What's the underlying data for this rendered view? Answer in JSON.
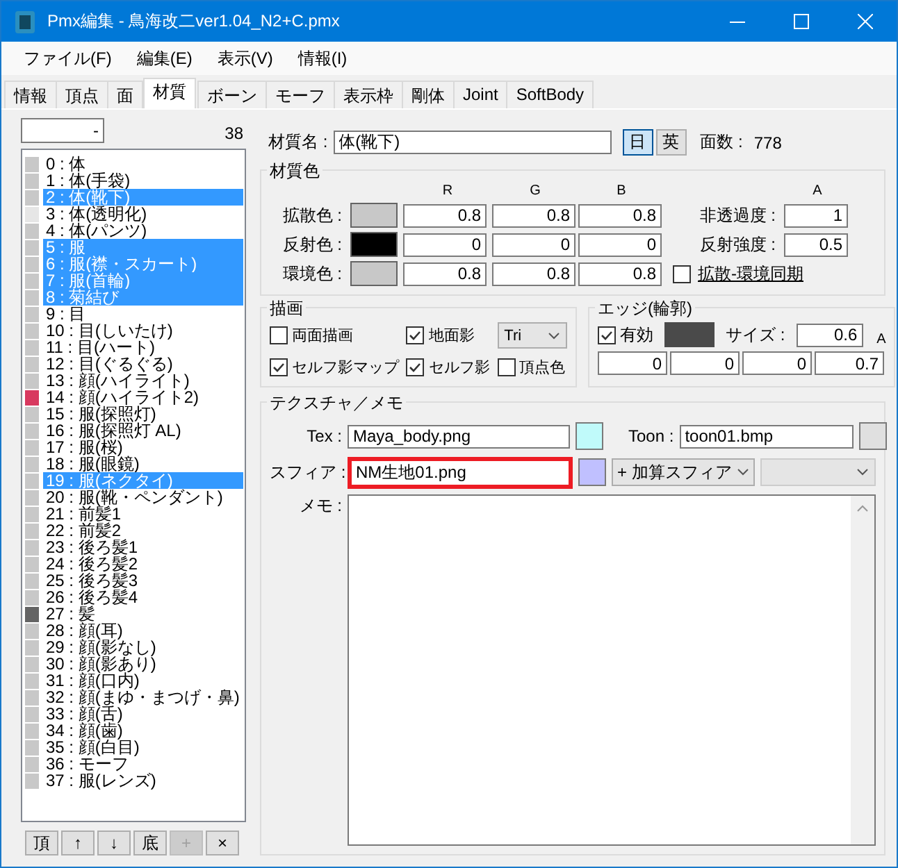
{
  "window": {
    "title": "Pmx編集 - 鳥海改二ver1.04_N2+C.pmx"
  },
  "menu": [
    "ファイル(F)",
    "編集(E)",
    "表示(V)",
    "情報(I)"
  ],
  "tabs": [
    {
      "label": "情報",
      "selected": false
    },
    {
      "label": "頂点",
      "selected": false
    },
    {
      "label": "面",
      "selected": false
    },
    {
      "label": "材質",
      "selected": true
    },
    {
      "label": "ボーン",
      "selected": false
    },
    {
      "label": "モーフ",
      "selected": false
    },
    {
      "label": "表示枠",
      "selected": false
    },
    {
      "label": "剛体",
      "selected": false
    },
    {
      "label": "Joint",
      "selected": false
    },
    {
      "label": "SoftBody",
      "selected": false
    }
  ],
  "filter": {
    "value": "-"
  },
  "count": "38",
  "materials": [
    {
      "label": "0 : 体",
      "color": "#c8c8c8",
      "selected": false
    },
    {
      "label": "1 : 体(手袋)",
      "color": "#c8c8c8",
      "selected": false
    },
    {
      "label": "2 : 体(靴下)",
      "color": "#c8c8c8",
      "selected": true
    },
    {
      "label": "3 : 体(透明化)",
      "color": "#e6e6e6",
      "selected": false
    },
    {
      "label": "4 : 体(パンツ)",
      "color": "#c8c8c8",
      "selected": false
    },
    {
      "label": "5 : 服",
      "color": "#c8c8c8",
      "selected": true
    },
    {
      "label": "6 : 服(襟・スカート)",
      "color": "#c8c8c8",
      "selected": true
    },
    {
      "label": "7 : 服(首輪)",
      "color": "#c8c8c8",
      "selected": true
    },
    {
      "label": "8 : 菊結び",
      "color": "#c8c8c8",
      "selected": true
    },
    {
      "label": "9 : 目",
      "color": "#c8c8c8",
      "selected": false
    },
    {
      "label": "10 : 目(しいたけ)",
      "color": "#c8c8c8",
      "selected": false
    },
    {
      "label": "11 : 目(ハート)",
      "color": "#c8c8c8",
      "selected": false
    },
    {
      "label": "12 : 目(ぐるぐる)",
      "color": "#c8c8c8",
      "selected": false
    },
    {
      "label": "13 : 顔(ハイライト)",
      "color": "#c8c8c8",
      "selected": false
    },
    {
      "label": "14 : 顔(ハイライト2)",
      "color": "#d8395f",
      "selected": false
    },
    {
      "label": "15 : 服(探照灯)",
      "color": "#c8c8c8",
      "selected": false
    },
    {
      "label": "16 : 服(探照灯 AL)",
      "color": "#c8c8c8",
      "selected": false
    },
    {
      "label": "17 : 服(桜)",
      "color": "#c8c8c8",
      "selected": false
    },
    {
      "label": "18 : 服(眼鏡)",
      "color": "#c8c8c8",
      "selected": false
    },
    {
      "label": "19 : 服(ネクタイ)",
      "color": "#c8c8c8",
      "selected": true
    },
    {
      "label": "20 : 服(靴・ペンダント)",
      "color": "#c8c8c8",
      "selected": false
    },
    {
      "label": "21 : 前髪1",
      "color": "#c8c8c8",
      "selected": false
    },
    {
      "label": "22 : 前髪2",
      "color": "#c8c8c8",
      "selected": false
    },
    {
      "label": "23 : 後ろ髪1",
      "color": "#c8c8c8",
      "selected": false
    },
    {
      "label": "24 : 後ろ髪2",
      "color": "#c8c8c8",
      "selected": false
    },
    {
      "label": "25 : 後ろ髪3",
      "color": "#c8c8c8",
      "selected": false
    },
    {
      "label": "26 : 後ろ髪4",
      "color": "#c8c8c8",
      "selected": false
    },
    {
      "label": "27 : 髪",
      "color": "#646464",
      "selected": false
    },
    {
      "label": "28 : 顔(耳)",
      "color": "#c8c8c8",
      "selected": false
    },
    {
      "label": "29 : 顔(影なし)",
      "color": "#c8c8c8",
      "selected": false
    },
    {
      "label": "30 : 顔(影あり)",
      "color": "#c8c8c8",
      "selected": false
    },
    {
      "label": "31 : 顔(口内)",
      "color": "#c8c8c8",
      "selected": false
    },
    {
      "label": "32 : 顔(まゆ・まつげ・鼻)",
      "color": "#c8c8c8",
      "selected": false
    },
    {
      "label": "33 : 顔(舌)",
      "color": "#c8c8c8",
      "selected": false
    },
    {
      "label": "34 : 顔(歯)",
      "color": "#c8c8c8",
      "selected": false
    },
    {
      "label": "35 : 顔(白目)",
      "color": "#c8c8c8",
      "selected": false
    },
    {
      "label": "36 : モーフ",
      "color": "#c8c8c8",
      "selected": false
    },
    {
      "label": "37 : 服(レンズ)",
      "color": "#c8c8c8",
      "selected": false
    }
  ],
  "list_buttons": [
    {
      "label": "頂",
      "disabled": false
    },
    {
      "label": "↑",
      "disabled": false
    },
    {
      "label": "↓",
      "disabled": false
    },
    {
      "label": "底",
      "disabled": false
    },
    {
      "label": "+",
      "disabled": true
    },
    {
      "label": "×",
      "disabled": false
    }
  ],
  "material_name": {
    "label": "材質名 :",
    "value": "体(靴下)"
  },
  "lang_buttons": [
    {
      "label": "日",
      "selected": true
    },
    {
      "label": "英",
      "selected": false
    }
  ],
  "face_count": {
    "label": "面数 :",
    "value": "778"
  },
  "material_color": {
    "title": "材質色",
    "headers": [
      "R",
      "G",
      "B"
    ],
    "a_header": "A",
    "rows": [
      {
        "label": "拡散色 :",
        "color": "#c8c8c8",
        "values": [
          "0.8",
          "0.8",
          "0.8"
        ]
      },
      {
        "label": "反射色 :",
        "color": "#000000",
        "values": [
          "0",
          "0",
          "0"
        ]
      },
      {
        "label": "環境色 :",
        "color": "#c8c8c8",
        "values": [
          "0.8",
          "0.8",
          "0.8"
        ]
      }
    ],
    "side": [
      {
        "label": "非透過度 :",
        "value": "1"
      },
      {
        "label": "反射強度 :",
        "value": "0.5"
      }
    ],
    "sync": {
      "label": "拡散-環境同期",
      "checked": false
    }
  },
  "drawing": {
    "title": "描画",
    "options": [
      {
        "kind": "checkbox",
        "label": "両面描画",
        "checked": false
      },
      {
        "kind": "checkbox",
        "label": "地面影",
        "checked": true
      },
      {
        "kind": "dropdown",
        "value": "Tri"
      },
      {
        "kind": "checkbox",
        "label": "セルフ影マップ",
        "checked": true
      },
      {
        "kind": "checkbox",
        "label": "セルフ影",
        "checked": true
      },
      {
        "kind": "checkbox",
        "label": "頂点色",
        "checked": false
      }
    ]
  },
  "edge": {
    "title": "エッジ(輪郭)",
    "enabled": {
      "label": "有効",
      "checked": true
    },
    "color": "#4a4a4a",
    "size": {
      "label": "サイズ :",
      "value": "0.6"
    },
    "a_header": "A",
    "values": [
      "0",
      "0",
      "0",
      "0.7"
    ]
  },
  "texture": {
    "title": "テクスチャ／メモ",
    "tex": {
      "label": "Tex :",
      "value": "Maya_body.png",
      "color": "#c0fafa"
    },
    "toon": {
      "label": "Toon :",
      "value": "toon01.bmp",
      "color": "#e0e0e0"
    },
    "sphere": {
      "label": "スフィア :",
      "value": "NM生地01.png",
      "color": "#c0c0ff",
      "highlighted": true
    },
    "sphere_mode": "+ 加算スフィア",
    "memo": {
      "label": "メモ :"
    }
  }
}
